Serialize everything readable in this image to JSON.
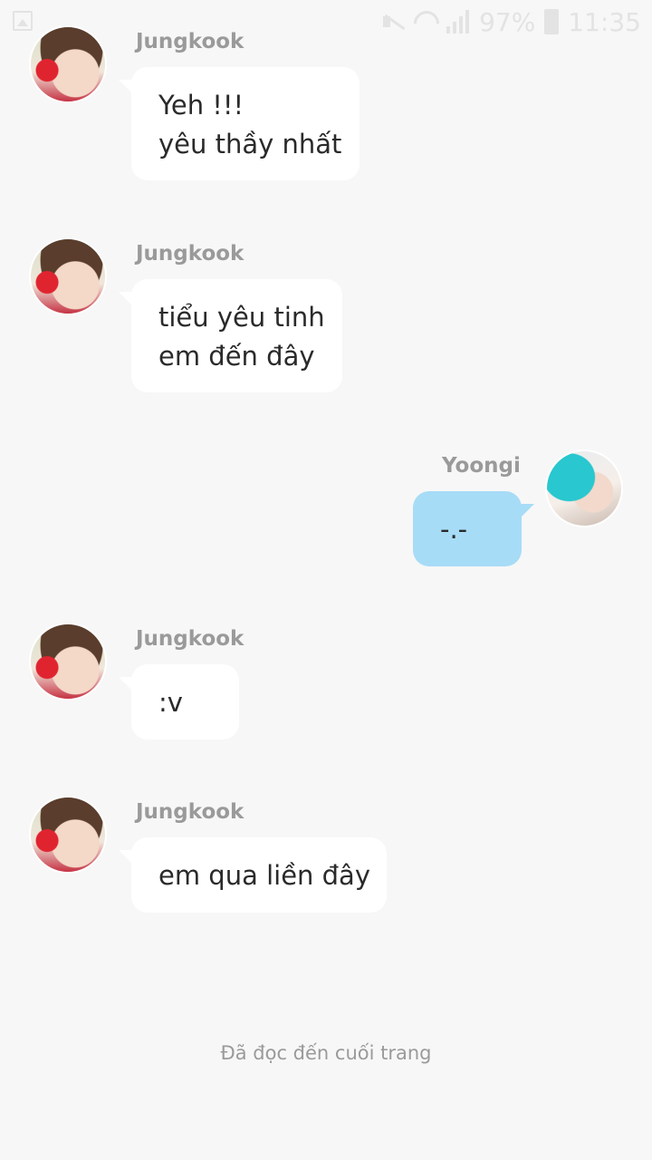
{
  "status_bar": {
    "battery": "97%",
    "time": "11:35",
    "icons": [
      "gallery-icon",
      "mute-icon",
      "wifi-icon",
      "signal-icon",
      "battery-icon"
    ]
  },
  "messages": [
    {
      "sender": "Jungkook",
      "lines": [
        "Yeh !!!",
        "yêu thầy nhất"
      ]
    },
    {
      "sender": "Jungkook",
      "lines": [
        "tiểu yêu tinh",
        "em đến đây"
      ]
    },
    {
      "sender": "Yoongi",
      "lines": [
        "-.-"
      ]
    },
    {
      "sender": "Jungkook",
      "lines": [
        ":v"
      ]
    },
    {
      "sender": "Jungkook",
      "lines": [
        "em qua liền đây"
      ]
    }
  ],
  "footer": {
    "end_label": "Đã đọc đến cuối trang"
  },
  "colors": {
    "background": "#f7f7f7",
    "incoming_bubble": "#ffffff",
    "outgoing_bubble": "#a7dcf7",
    "name_text": "#9a9a9a",
    "message_text": "#2a2a2a"
  }
}
